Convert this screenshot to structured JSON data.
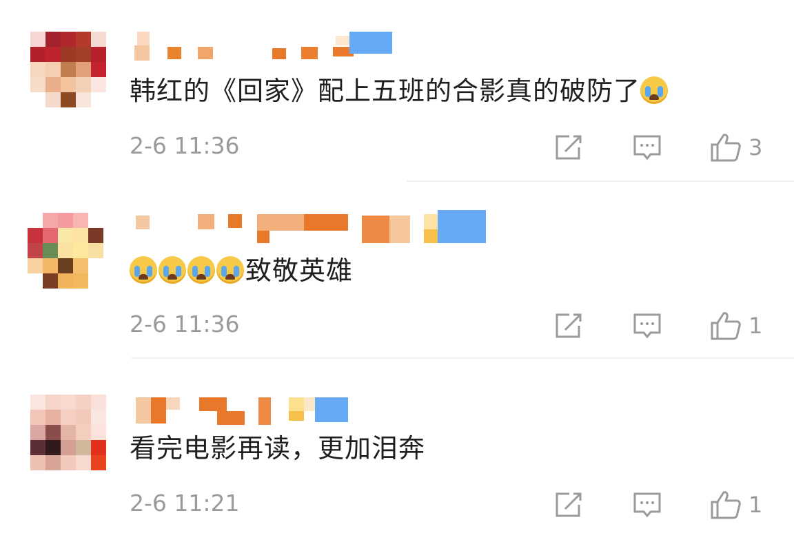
{
  "comments": [
    {
      "text": "韩红的《回家》配上五班的合影真的破防了",
      "emoji_count": 1,
      "emoji_position": "end",
      "emoji_icon": "crying-face-icon",
      "time": "2-6 11:36",
      "likes": "3"
    },
    {
      "text": "致敬英雄",
      "emoji_count": 4,
      "emoji_position": "start",
      "emoji_icon": "crying-face-icon",
      "time": "2-6 11:36",
      "likes": "1"
    },
    {
      "text": "看完电影再读，更加泪奔",
      "emoji_count": 0,
      "time": "2-6 11:21",
      "likes": "1"
    }
  ],
  "icons": {
    "forward": "forward-icon",
    "reply": "comment-icon",
    "like": "thumbs-up-icon"
  },
  "colors": {
    "text": "#1f1f1f",
    "meta": "#9a9a9a",
    "emoji": "#f7c948",
    "name_blur_orange": "#e8782a",
    "name_blur_blue": "#66aaf5"
  }
}
